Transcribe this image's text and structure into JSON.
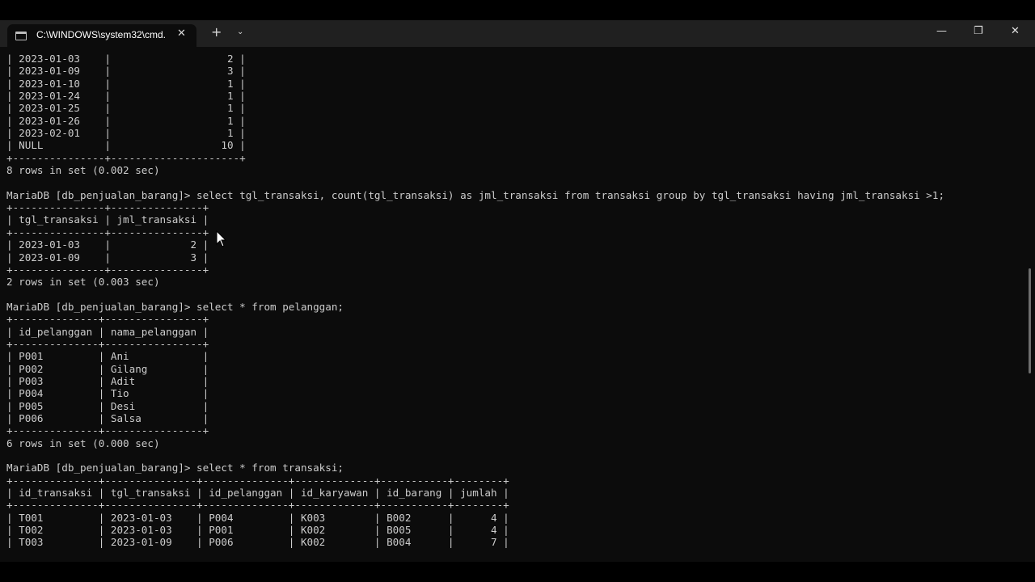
{
  "window": {
    "tab_title": "C:\\WINDOWS\\system32\\cmd.",
    "tab_close_glyph": "✕",
    "new_tab_glyph": "+",
    "dropdown_glyph": "⌄",
    "minimize_glyph": "—",
    "maximize_glyph": "❐",
    "close_glyph": "✕",
    "icons": [
      "terminal-icon",
      "close-icon",
      "plus-icon",
      "chevron-down-icon",
      "minimize-icon",
      "restore-icon",
      "close-icon"
    ]
  },
  "terminal": {
    "lines": [
      "| 2023-01-03    |                   2 |",
      "| 2023-01-09    |                   3 |",
      "| 2023-01-10    |                   1 |",
      "| 2023-01-24    |                   1 |",
      "| 2023-01-25    |                   1 |",
      "| 2023-01-26    |                   1 |",
      "| 2023-02-01    |                   1 |",
      "| NULL          |                  10 |",
      "+---------------+---------------------+",
      "8 rows in set (0.002 sec)",
      "",
      "MariaDB [db_penjualan_barang]> select tgl_transaksi, count(tgl_transaksi) as jml_transaksi from transaksi group by tgl_transaksi having jml_transaksi >1;",
      "+---------------+---------------+",
      "| tgl_transaksi | jml_transaksi |",
      "+---------------+---------------+",
      "| 2023-01-03    |             2 |",
      "| 2023-01-09    |             3 |",
      "+---------------+---------------+",
      "2 rows in set (0.003 sec)",
      "",
      "MariaDB [db_penjualan_barang]> select * from pelanggan;",
      "+--------------+----------------+",
      "| id_pelanggan | nama_pelanggan |",
      "+--------------+----------------+",
      "| P001         | Ani            |",
      "| P002         | Gilang         |",
      "| P003         | Adit           |",
      "| P004         | Tio            |",
      "| P005         | Desi           |",
      "| P006         | Salsa          |",
      "+--------------+----------------+",
      "6 rows in set (0.000 sec)",
      "",
      "MariaDB [db_penjualan_barang]> select * from transaksi;",
      "+--------------+---------------+--------------+-------------+-----------+--------+",
      "| id_transaksi | tgl_transaksi | id_pelanggan | id_karyawan | id_barang | jumlah |",
      "+--------------+---------------+--------------+-------------+-----------+--------+",
      "| T001         | 2023-01-03    | P004         | K003        | B002      |      4 |",
      "| T002         | 2023-01-03    | P001         | K002        | B005      |      4 |",
      "| T003         | 2023-01-09    | P006         | K002        | B004      |      7 |"
    ]
  }
}
